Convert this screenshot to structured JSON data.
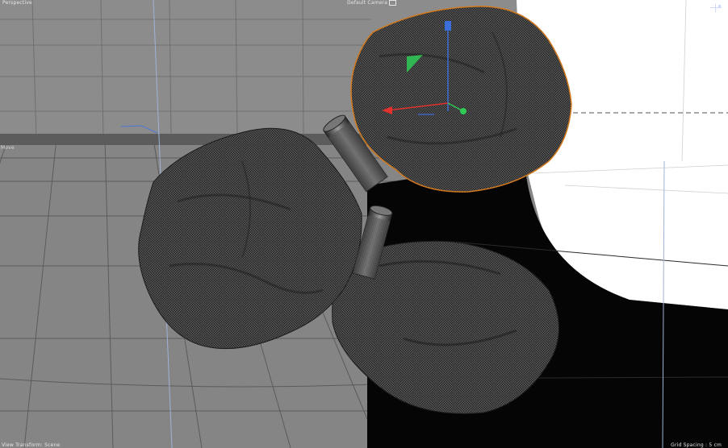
{
  "viewport": {
    "view_name": "Perspective",
    "camera_label": "Default Camera",
    "side_label": "Move",
    "status_left": "View Transform: Scene",
    "grid_spacing_label": "Grid Spacing : 5 cm"
  },
  "scene": {
    "objects": [
      {
        "name": "rock-top-right",
        "selected": true
      },
      {
        "name": "rock-left",
        "selected": false
      },
      {
        "name": "rock-bottom",
        "selected": false
      },
      {
        "name": "cylinder-upper",
        "selected": false
      },
      {
        "name": "cylinder-lower",
        "selected": false
      }
    ],
    "axis_colors": {
      "x": "#e2312e",
      "y": "#3a6fd9",
      "z": "#2fcb55"
    },
    "selection_color": "#d27a1f",
    "grid_color": "#5a5a5a",
    "mesh_color": "#3a3a3a"
  },
  "icons": [
    "camera-icon",
    "navigation-icon"
  ]
}
